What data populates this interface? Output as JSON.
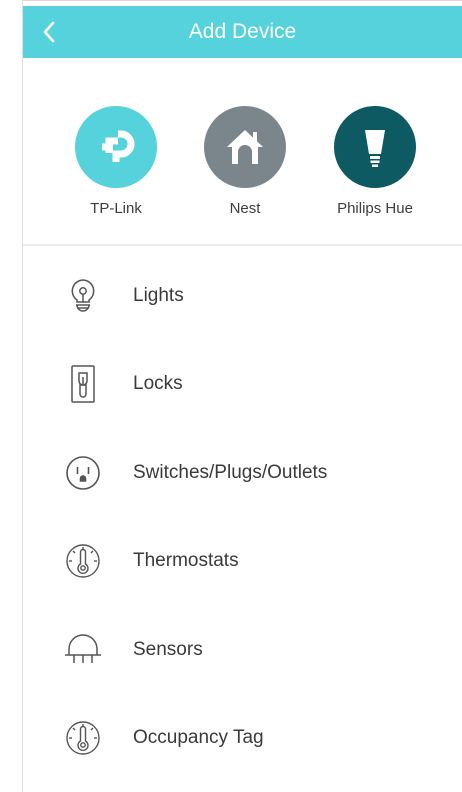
{
  "header": {
    "title": "Add Device",
    "back_icon": "chevron-left-icon",
    "background_color": "#56d2dd"
  },
  "brands": [
    {
      "label": "TP-Link",
      "icon": "tp-link-logo-icon",
      "color": "#56d2dd"
    },
    {
      "label": "Nest",
      "icon": "nest-house-icon",
      "color": "#7b868c"
    },
    {
      "label": "Philips Hue",
      "icon": "hue-bulb-icon",
      "color": "#0d5a63"
    }
  ],
  "categories": [
    {
      "label": "Lights",
      "icon": "light-bulb-icon"
    },
    {
      "label": "Locks",
      "icon": "lock-icon"
    },
    {
      "label": "Switches/Plugs/Outlets",
      "icon": "outlet-icon"
    },
    {
      "label": "Thermostats",
      "icon": "thermostat-icon"
    },
    {
      "label": "Sensors",
      "icon": "sensor-icon"
    },
    {
      "label": "Occupancy Tag",
      "icon": "occupancy-tag-icon"
    }
  ]
}
